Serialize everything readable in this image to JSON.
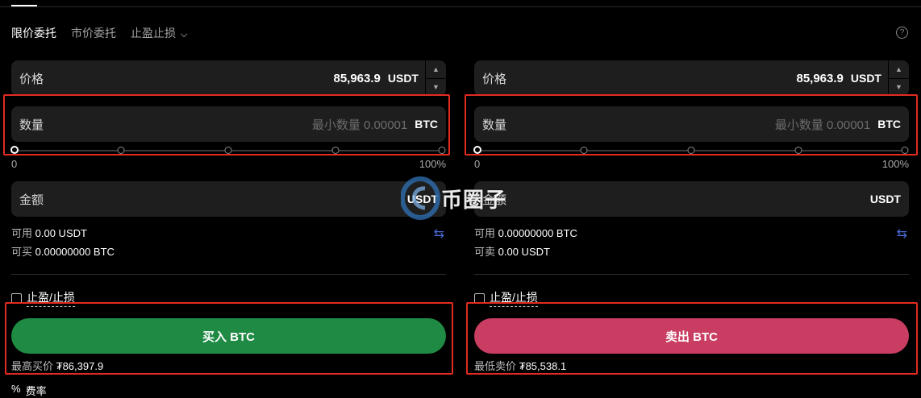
{
  "tabs": [
    {
      "label": "限价委托"
    },
    {
      "label": "市价委托"
    },
    {
      "label": "止盈止损"
    }
  ],
  "help_icon": "?",
  "buy": {
    "price_label": "价格",
    "price_value": "85,963.9",
    "price_unit": "USDT",
    "qty_label": "数量",
    "qty_placeholder": "最小数量 0.00001",
    "qty_unit": "BTC",
    "slider_min": "0",
    "slider_max": "100%",
    "slider_value": 0,
    "amount_label": "金额",
    "amount_unit": "USDT",
    "avail_label": "可用",
    "avail_value": "0.00 USDT",
    "can_label": "可买",
    "can_value": "0.00000000 BTC",
    "tpsl_label": "止盈/止损",
    "button_label": "买入 BTC",
    "best_label": "最高买价",
    "best_value": "₮86,397.9"
  },
  "sell": {
    "price_label": "价格",
    "price_value": "85,963.9",
    "price_unit": "USDT",
    "qty_label": "数量",
    "qty_placeholder": "最小数量 0.00001",
    "qty_unit": "BTC",
    "slider_min": "0",
    "slider_max": "100%",
    "slider_value": 0,
    "amount_label": "金额",
    "amount_unit": "USDT",
    "avail_label": "可用",
    "avail_value": "0.00000000 BTC",
    "can_label": "可卖",
    "can_value": "0.00 USDT",
    "tpsl_label": "止盈/止损",
    "button_label": "卖出 BTC",
    "best_label": "最低卖价",
    "best_value": "₮85,538.1"
  },
  "fee": {
    "icon": "%",
    "label": "费率"
  },
  "watermark": {
    "text": "币圈子"
  },
  "colors": {
    "buy": "#1f8a44",
    "sell": "#c93d62",
    "highlight_box": "#e02c1f",
    "swap_icon": "#4c6bdc"
  }
}
